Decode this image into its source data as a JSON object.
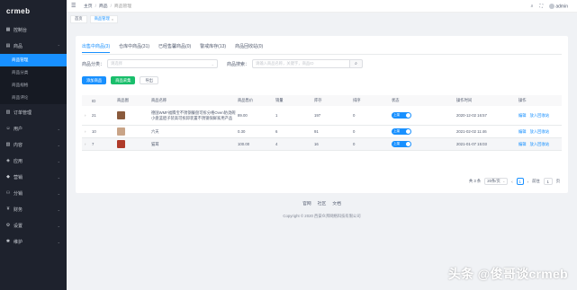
{
  "app": {
    "logo": "crmeb"
  },
  "sidebar": {
    "items": [
      {
        "icon": "dashboard-icon",
        "glyph": "▦",
        "label": "控制台"
      },
      {
        "icon": "product-icon",
        "glyph": "▤",
        "label": "商品",
        "open": true
      },
      {
        "icon": "order-icon",
        "glyph": "▥",
        "label": "订单管理"
      },
      {
        "icon": "user-icon",
        "glyph": "☺",
        "label": "用户"
      },
      {
        "icon": "content-icon",
        "glyph": "▧",
        "label": "内容"
      },
      {
        "icon": "app-icon",
        "glyph": "◈",
        "label": "应用"
      },
      {
        "icon": "marketing-icon",
        "glyph": "◆",
        "label": "营销"
      },
      {
        "icon": "distribution-icon",
        "glyph": "⚇",
        "label": "分销"
      },
      {
        "icon": "finance-icon",
        "glyph": "¥",
        "label": "财务"
      },
      {
        "icon": "settings-icon",
        "glyph": "⚙",
        "label": "设置"
      },
      {
        "icon": "maintain-icon",
        "glyph": "✱",
        "label": "维护"
      }
    ],
    "submenu": [
      "商品管理",
      "商品分类",
      "商品规格",
      "商品评论"
    ]
  },
  "header": {
    "breadcrumb": [
      "主页",
      "商品",
      "商品管理"
    ],
    "admin": "admin"
  },
  "tagbar": {
    "home": "首页",
    "current": "商品管理"
  },
  "tabs": [
    "出售中商品(3)",
    "仓库中商品(31)",
    "已经售馨商品(0)",
    "警戒库存(13)",
    "商品回收站(0)"
  ],
  "filters": {
    "category_label": "商品分类：",
    "category_placeholder": "请选择",
    "search_label": "商品搜索：",
    "search_placeholder": "请输入商品名称，关键字，商品ID"
  },
  "buttons": {
    "add": "添加商品",
    "collect": "商品采集",
    "export": "导出"
  },
  "table": {
    "headers": [
      "",
      "ID",
      "商品图",
      "商品名称",
      "商品售价",
      "销量",
      "库存",
      "排序",
      "状态",
      "操作时间",
      "操作"
    ],
    "rows": [
      {
        "expand": "›",
        "id": "21",
        "thumb_color": "#8a5a3c",
        "name": "德国WMF福腾宝不锈钢餐盘可拆分格Oven防烫碗小盘蓝胆子装高可拆卸装置不锈钢保鲜家用产品",
        "price": "89.00",
        "sales": "1",
        "stock": "197",
        "sort": "0",
        "status": "上架",
        "time": "2020-12-02 16:57",
        "actions": [
          "编辑",
          "放入回收站"
        ]
      },
      {
        "expand": "›",
        "id": "10",
        "thumb_color": "#c9a487",
        "name": "六天",
        "price": "0.30",
        "sales": "6",
        "stock": "91",
        "sort": "0",
        "status": "上架",
        "time": "2021-02-02 11:46",
        "actions": [
          "编辑",
          "放入回收站"
        ]
      },
      {
        "expand": "›",
        "id": "7",
        "thumb_color": "#b03b2a",
        "name": "猫耳",
        "price": "100.00",
        "sales": "4",
        "stock": "16",
        "sort": "0",
        "status": "上架",
        "time": "2021-01-07 15:03",
        "actions": [
          "编辑",
          "放入回收站"
        ]
      }
    ]
  },
  "pagination": {
    "total": "共 3 条",
    "page_size": "20条/页",
    "prev": "‹",
    "current": "1",
    "next": "›",
    "goto": "前往",
    "goto_value": "1",
    "page_suffix": "页"
  },
  "footer": {
    "links": [
      "官网",
      "社区",
      "文档"
    ],
    "copyright": "Copyright © 2020 西安众邦网络科技有限公司"
  },
  "watermark": "头条 @俊哥谈crmeb",
  "colors": {
    "primary": "#1890ff",
    "success": "#19be6b",
    "sidebar_bg": "#1e222d"
  }
}
